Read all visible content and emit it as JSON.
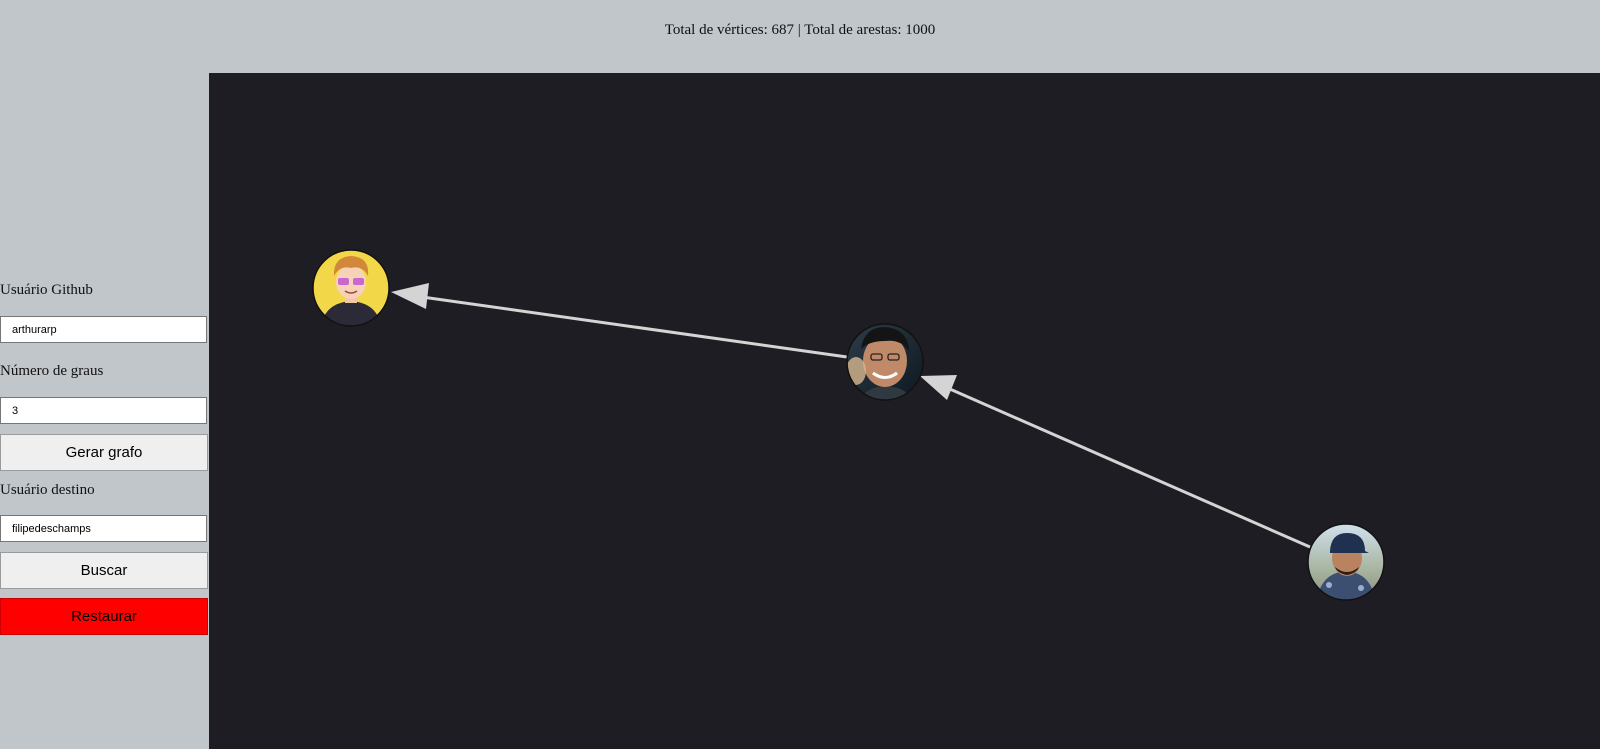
{
  "header": {
    "stats_text": "Total de vértices: 687 | Total de arestas: 1000"
  },
  "sidebar": {
    "github_user_label": "Usuário Github",
    "github_user_value": "arthurarp",
    "degrees_label": "Número de graus",
    "degrees_value": "3",
    "generate_button": "Gerar grafo",
    "target_user_label": "Usuário destino",
    "target_user_value": "filipedeschamps",
    "search_button": "Buscar",
    "reset_button": "Restaurar"
  },
  "colors": {
    "page_bg": "#c1c6ca",
    "graph_bg": "#1e1d23",
    "edge": "#d4d4d4",
    "reset_button": "#ff0000"
  },
  "graph": {
    "nodes": [
      {
        "id": "node-a",
        "avatar": "cartoon-avatar-icon"
      },
      {
        "id": "node-b",
        "avatar": "user-photo-avatar-icon"
      },
      {
        "id": "node-c",
        "avatar": "user-photo-avatar-icon"
      }
    ],
    "edges": [
      {
        "from": "node-b",
        "to": "node-a"
      },
      {
        "from": "node-c",
        "to": "node-b"
      }
    ]
  }
}
